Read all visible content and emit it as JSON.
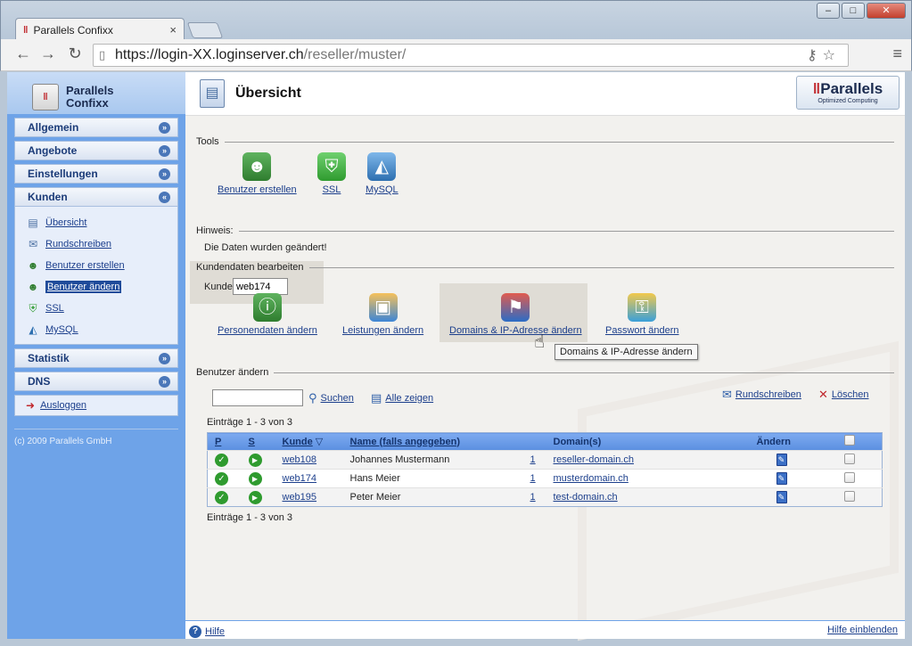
{
  "browser": {
    "tab_title": "Parallels Confixx",
    "tab_close": "×",
    "url_host": "https://login-XX.loginserver.ch",
    "url_path": "/reseller/muster/",
    "window_controls": [
      "‒",
      "□",
      "✕"
    ]
  },
  "sidebar": {
    "logo_line1": "Parallels",
    "logo_line2": "Confixx",
    "menu": [
      {
        "label": "Allgemein"
      },
      {
        "label": "Angebote"
      },
      {
        "label": "Einstellungen"
      },
      {
        "label": "Kunden"
      }
    ],
    "kunden_items": [
      {
        "label": "Übersicht",
        "icon": "document-icon"
      },
      {
        "label": "Rundschreiben",
        "icon": "newsletter-icon"
      },
      {
        "label": "Benutzer erstellen",
        "icon": "user-add-icon"
      },
      {
        "label": "Benutzer ändern",
        "icon": "user-edit-icon"
      },
      {
        "label": "SSL",
        "icon": "ssl-icon"
      },
      {
        "label": "MySQL",
        "icon": "mysql-icon"
      }
    ],
    "menu_after": [
      {
        "label": "Statistik"
      },
      {
        "label": "DNS"
      }
    ],
    "logout_label": "Ausloggen",
    "copyright": "(c) 2009 Parallels GmbH"
  },
  "header": {
    "title": "Übersicht",
    "brand_name": "Parallels",
    "brand_tagline": "Optimized Computing"
  },
  "tools": {
    "section_label": "Tools",
    "items": [
      {
        "label": "Benutzer erstellen"
      },
      {
        "label": "SSL"
      },
      {
        "label": "MySQL"
      }
    ]
  },
  "hint": {
    "section_label": "Hinweis:",
    "text": "Die Daten wurden geändert!"
  },
  "kundendaten": {
    "section_label": "Kundendaten bearbeiten",
    "kunde_label": "Kunde",
    "kunde_value": "web174",
    "actions": [
      {
        "label": "Personendaten ändern"
      },
      {
        "label": "Leistungen ändern"
      },
      {
        "label": "Domains & IP-Adresse ändern"
      },
      {
        "label": "Passwort ändern"
      }
    ],
    "tooltip": "Domains & IP-Adresse ändern"
  },
  "benutzer": {
    "section_label": "Benutzer ändern",
    "search_value": "",
    "search_label": "Suchen",
    "show_all_label": "Alle zeigen",
    "newsletter_label": "Rundschreiben",
    "delete_label": "Löschen",
    "entries_top": "Einträge 1 - 3 von 3",
    "entries_bottom": "Einträge 1 - 3 von 3",
    "columns": {
      "p": "P",
      "s": "S",
      "kunde": "Kunde",
      "name": "Name (falls angegeben)",
      "domains": "Domain(s)",
      "aendern": "Ändern"
    },
    "rows": [
      {
        "kunde": "web108",
        "name": "Johannes Mustermann",
        "count": "1",
        "domain": "reseller-domain.ch"
      },
      {
        "kunde": "web174",
        "name": "Hans Meier",
        "count": "1",
        "domain": "musterdomain.ch"
      },
      {
        "kunde": "web195",
        "name": "Peter Meier",
        "count": "1",
        "domain": "test-domain.ch"
      }
    ]
  },
  "footer": {
    "help_label": "Hilfe",
    "help_show_label": "Hilfe einblenden"
  }
}
